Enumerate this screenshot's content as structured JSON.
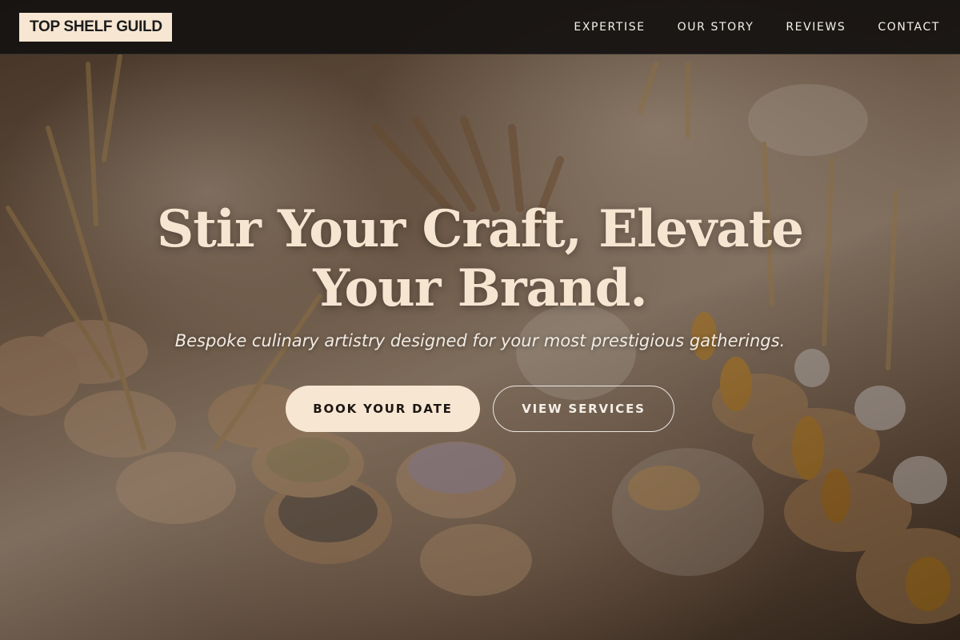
{
  "brand": {
    "logo_text": "TOP SHELF GUILD"
  },
  "nav": {
    "items": [
      {
        "label": "EXPERTISE"
      },
      {
        "label": "OUR STORY"
      },
      {
        "label": "REVIEWS"
      },
      {
        "label": "CONTACT"
      }
    ]
  },
  "hero": {
    "headline": "Stir Your Craft, Elevate Your Brand.",
    "tagline": "Bespoke culinary artistry designed for your most prestigious gatherings.",
    "primary_cta": "BOOK YOUR DATE",
    "secondary_cta": "VIEW SERVICES"
  },
  "colors": {
    "cream_accent": "#f7e6d2",
    "header_bg": "#161311",
    "headline_text": "#f6e5d1"
  }
}
